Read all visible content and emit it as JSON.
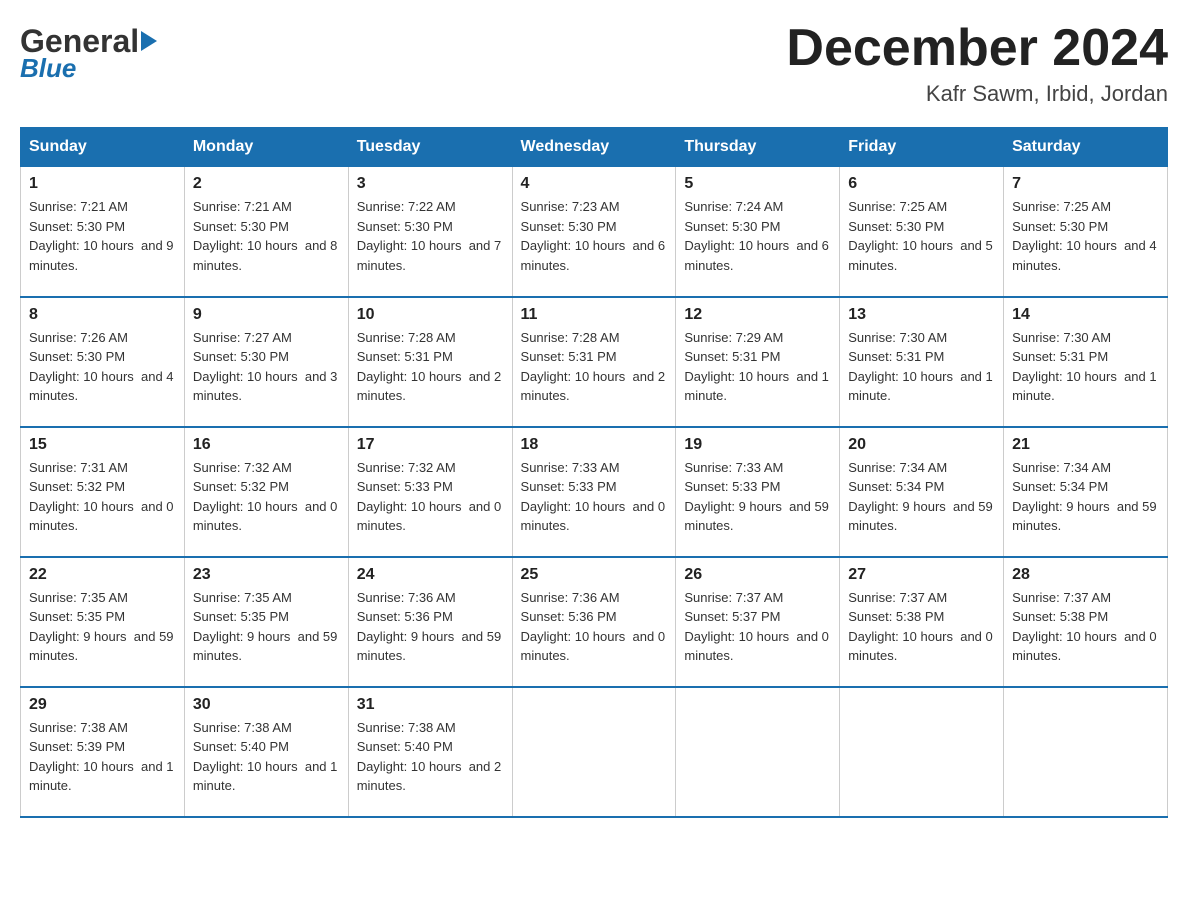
{
  "header": {
    "logo_general": "General",
    "logo_blue": "Blue",
    "month_title": "December 2024",
    "location": "Kafr Sawm, Irbid, Jordan"
  },
  "days_of_week": [
    "Sunday",
    "Monday",
    "Tuesday",
    "Wednesday",
    "Thursday",
    "Friday",
    "Saturday"
  ],
  "weeks": [
    [
      {
        "day": "1",
        "sunrise": "7:21 AM",
        "sunset": "5:30 PM",
        "daylight": "10 hours and 9 minutes."
      },
      {
        "day": "2",
        "sunrise": "7:21 AM",
        "sunset": "5:30 PM",
        "daylight": "10 hours and 8 minutes."
      },
      {
        "day": "3",
        "sunrise": "7:22 AM",
        "sunset": "5:30 PM",
        "daylight": "10 hours and 7 minutes."
      },
      {
        "day": "4",
        "sunrise": "7:23 AM",
        "sunset": "5:30 PM",
        "daylight": "10 hours and 6 minutes."
      },
      {
        "day": "5",
        "sunrise": "7:24 AM",
        "sunset": "5:30 PM",
        "daylight": "10 hours and 6 minutes."
      },
      {
        "day": "6",
        "sunrise": "7:25 AM",
        "sunset": "5:30 PM",
        "daylight": "10 hours and 5 minutes."
      },
      {
        "day": "7",
        "sunrise": "7:25 AM",
        "sunset": "5:30 PM",
        "daylight": "10 hours and 4 minutes."
      }
    ],
    [
      {
        "day": "8",
        "sunrise": "7:26 AM",
        "sunset": "5:30 PM",
        "daylight": "10 hours and 4 minutes."
      },
      {
        "day": "9",
        "sunrise": "7:27 AM",
        "sunset": "5:30 PM",
        "daylight": "10 hours and 3 minutes."
      },
      {
        "day": "10",
        "sunrise": "7:28 AM",
        "sunset": "5:31 PM",
        "daylight": "10 hours and 2 minutes."
      },
      {
        "day": "11",
        "sunrise": "7:28 AM",
        "sunset": "5:31 PM",
        "daylight": "10 hours and 2 minutes."
      },
      {
        "day": "12",
        "sunrise": "7:29 AM",
        "sunset": "5:31 PM",
        "daylight": "10 hours and 1 minute."
      },
      {
        "day": "13",
        "sunrise": "7:30 AM",
        "sunset": "5:31 PM",
        "daylight": "10 hours and 1 minute."
      },
      {
        "day": "14",
        "sunrise": "7:30 AM",
        "sunset": "5:31 PM",
        "daylight": "10 hours and 1 minute."
      }
    ],
    [
      {
        "day": "15",
        "sunrise": "7:31 AM",
        "sunset": "5:32 PM",
        "daylight": "10 hours and 0 minutes."
      },
      {
        "day": "16",
        "sunrise": "7:32 AM",
        "sunset": "5:32 PM",
        "daylight": "10 hours and 0 minutes."
      },
      {
        "day": "17",
        "sunrise": "7:32 AM",
        "sunset": "5:33 PM",
        "daylight": "10 hours and 0 minutes."
      },
      {
        "day": "18",
        "sunrise": "7:33 AM",
        "sunset": "5:33 PM",
        "daylight": "10 hours and 0 minutes."
      },
      {
        "day": "19",
        "sunrise": "7:33 AM",
        "sunset": "5:33 PM",
        "daylight": "9 hours and 59 minutes."
      },
      {
        "day": "20",
        "sunrise": "7:34 AM",
        "sunset": "5:34 PM",
        "daylight": "9 hours and 59 minutes."
      },
      {
        "day": "21",
        "sunrise": "7:34 AM",
        "sunset": "5:34 PM",
        "daylight": "9 hours and 59 minutes."
      }
    ],
    [
      {
        "day": "22",
        "sunrise": "7:35 AM",
        "sunset": "5:35 PM",
        "daylight": "9 hours and 59 minutes."
      },
      {
        "day": "23",
        "sunrise": "7:35 AM",
        "sunset": "5:35 PM",
        "daylight": "9 hours and 59 minutes."
      },
      {
        "day": "24",
        "sunrise": "7:36 AM",
        "sunset": "5:36 PM",
        "daylight": "9 hours and 59 minutes."
      },
      {
        "day": "25",
        "sunrise": "7:36 AM",
        "sunset": "5:36 PM",
        "daylight": "10 hours and 0 minutes."
      },
      {
        "day": "26",
        "sunrise": "7:37 AM",
        "sunset": "5:37 PM",
        "daylight": "10 hours and 0 minutes."
      },
      {
        "day": "27",
        "sunrise": "7:37 AM",
        "sunset": "5:38 PM",
        "daylight": "10 hours and 0 minutes."
      },
      {
        "day": "28",
        "sunrise": "7:37 AM",
        "sunset": "5:38 PM",
        "daylight": "10 hours and 0 minutes."
      }
    ],
    [
      {
        "day": "29",
        "sunrise": "7:38 AM",
        "sunset": "5:39 PM",
        "daylight": "10 hours and 1 minute."
      },
      {
        "day": "30",
        "sunrise": "7:38 AM",
        "sunset": "5:40 PM",
        "daylight": "10 hours and 1 minute."
      },
      {
        "day": "31",
        "sunrise": "7:38 AM",
        "sunset": "5:40 PM",
        "daylight": "10 hours and 2 minutes."
      },
      null,
      null,
      null,
      null
    ]
  ],
  "labels": {
    "sunrise": "Sunrise:",
    "sunset": "Sunset:",
    "daylight": "Daylight:"
  }
}
